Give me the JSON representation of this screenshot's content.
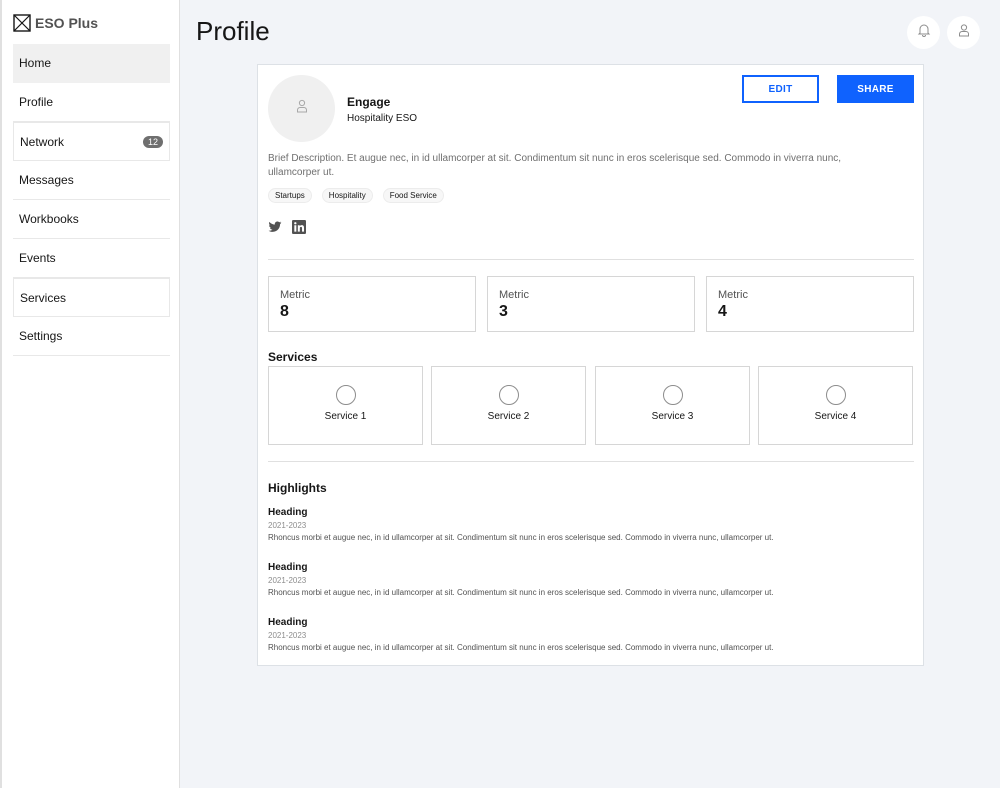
{
  "app": {
    "name": "ESO Plus"
  },
  "sidebar": {
    "items": [
      {
        "label": "Home"
      },
      {
        "label": "Profile"
      },
      {
        "label": "Network",
        "badge": "12"
      },
      {
        "label": "Messages"
      },
      {
        "label": "Workbooks"
      },
      {
        "label": "Events"
      },
      {
        "label": "Services"
      },
      {
        "label": "Settings"
      }
    ]
  },
  "header": {
    "title": "Profile",
    "icons": [
      "bell-icon",
      "user-icon"
    ]
  },
  "profile": {
    "name": "Engage",
    "subtitle": "Hospitality ESO",
    "edit_label": "EDIT",
    "share_label": "SHARE",
    "description": "Brief Description. Et augue nec, in id ullamcorper at sit. Condimentum sit nunc in eros scelerisque sed. Commodo in viverra nunc, ullamcorper ut.",
    "tags": [
      "Startups",
      "Hospitality",
      "Food Service"
    ],
    "socials": [
      "twitter-icon",
      "linkedin-icon"
    ]
  },
  "metrics": [
    {
      "label": "Metric",
      "value": "8"
    },
    {
      "label": "Metric",
      "value": "3"
    },
    {
      "label": "Metric",
      "value": "4"
    }
  ],
  "services": {
    "title": "Services",
    "items": [
      {
        "label": "Service 1"
      },
      {
        "label": "Service 2"
      },
      {
        "label": "Service 3"
      },
      {
        "label": "Service 4"
      }
    ]
  },
  "highlights": {
    "title": "Highlights",
    "items": [
      {
        "heading": "Heading",
        "date": "2021-2023",
        "text": "Rhoncus morbi et augue nec, in id ullamcorper at sit. Condimentum sit nunc in eros scelerisque sed. Commodo in viverra nunc, ullamcorper ut."
      },
      {
        "heading": "Heading",
        "date": "2021-2023",
        "text": "Rhoncus morbi et augue nec, in id ullamcorper at sit. Condimentum sit nunc in eros scelerisque sed. Commodo in viverra nunc, ullamcorper ut."
      },
      {
        "heading": "Heading",
        "date": "2021-2023",
        "text": "Rhoncus morbi et augue nec, in id ullamcorper at sit. Condimentum sit nunc in eros scelerisque sed. Commodo in viverra nunc, ullamcorper ut."
      }
    ]
  },
  "colors": {
    "accent": "#0f62fe",
    "background": "#f2f4f8"
  }
}
